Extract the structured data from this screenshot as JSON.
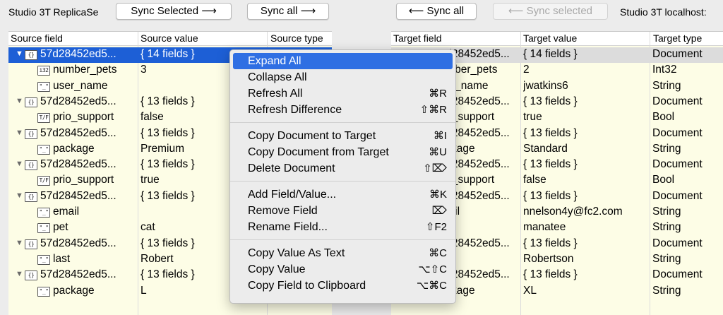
{
  "toolbar": {
    "left_title": "Studio 3T ReplicaSe",
    "sync_selected_right": "Sync Selected ⟶",
    "sync_all_right": "Sync all ⟶",
    "sync_all_left": "⟵ Sync all",
    "sync_selected_left": "⟵ Sync selected",
    "right_title": "Studio 3T localhost:"
  },
  "source": {
    "headers": [
      "Source field",
      "Source value",
      "Source type"
    ],
    "rows": [
      {
        "field": "57d28452ed5...",
        "value": "{ 14 fields }",
        "icon": "{}",
        "expand": true,
        "indent": 0,
        "selected": true
      },
      {
        "field": "number_pets",
        "value": "3",
        "icon": "i32",
        "expand": false,
        "indent": 1
      },
      {
        "field": "user_name",
        "value": "",
        "icon": "\"_\"",
        "expand": false,
        "indent": 1
      },
      {
        "field": "57d28452ed5...",
        "value": "{ 13 fields }",
        "icon": "{}",
        "expand": true,
        "indent": 0
      },
      {
        "field": "prio_support",
        "value": "false",
        "icon": "T/F",
        "expand": false,
        "indent": 1
      },
      {
        "field": "57d28452ed5...",
        "value": "{ 13 fields }",
        "icon": "{}",
        "expand": true,
        "indent": 0
      },
      {
        "field": "package",
        "value": "Premium",
        "icon": "\"_\"",
        "expand": false,
        "indent": 1
      },
      {
        "field": "57d28452ed5...",
        "value": "{ 13 fields }",
        "icon": "{}",
        "expand": true,
        "indent": 0
      },
      {
        "field": "prio_support",
        "value": "true",
        "icon": "T/F",
        "expand": false,
        "indent": 1
      },
      {
        "field": "57d28452ed5...",
        "value": "{ 13 fields }",
        "icon": "{}",
        "expand": true,
        "indent": 0
      },
      {
        "field": "email",
        "value": "",
        "icon": "\"_\"",
        "expand": false,
        "indent": 1
      },
      {
        "field": "pet",
        "value": "cat",
        "icon": "\"_\"",
        "expand": false,
        "indent": 1
      },
      {
        "field": "57d28452ed5...",
        "value": "{ 13 fields }",
        "icon": "{}",
        "expand": true,
        "indent": 0
      },
      {
        "field": "last",
        "value": "Robert",
        "icon": "\"_\"",
        "expand": false,
        "indent": 1
      },
      {
        "field": "57d28452ed5...",
        "value": "{ 13 fields }",
        "icon": "{}",
        "expand": true,
        "indent": 0
      },
      {
        "field": "package",
        "value": "L",
        "icon": "\"_\"",
        "expand": false,
        "indent": 1
      }
    ]
  },
  "target": {
    "headers": [
      "Target field",
      "Target value",
      "Target type"
    ],
    "rows": [
      {
        "field": "57d28452ed5...",
        "value": "{ 14 fields }",
        "type": "Document",
        "selected": true
      },
      {
        "field": "number_pets",
        "value": "2",
        "type": "Int32"
      },
      {
        "field": "user_name",
        "value": "jwatkins6",
        "type": "String"
      },
      {
        "field": "57d28452ed5...",
        "value": "{ 13 fields }",
        "type": "Document"
      },
      {
        "field": "prio_support",
        "value": "true",
        "type": "Bool"
      },
      {
        "field": "57d28452ed5...",
        "value": "{ 13 fields }",
        "type": "Document"
      },
      {
        "field": "package",
        "value": "Standard",
        "type": "String"
      },
      {
        "field": "57d28452ed5...",
        "value": "{ 13 fields }",
        "type": "Document"
      },
      {
        "field": "prio_support",
        "value": "false",
        "type": "Bool"
      },
      {
        "field": "57d28452ed5...",
        "value": "{ 13 fields }",
        "type": "Document"
      },
      {
        "field": "email",
        "value": "nnelson4y@fc2.com",
        "type": "String"
      },
      {
        "field": "pet",
        "value": "manatee",
        "type": "String"
      },
      {
        "field": "57d28452ed5...",
        "value": "{ 13 fields }",
        "type": "Document"
      },
      {
        "field": "last",
        "value": "Robertson",
        "type": "String"
      },
      {
        "field": "57d28452ed5...",
        "value": "{ 13 fields }",
        "type": "Document"
      },
      {
        "field": "package",
        "value": "XL",
        "type": "String"
      }
    ]
  },
  "context_menu": {
    "groups": [
      [
        {
          "label": "Expand All",
          "shortcut": "",
          "highlighted": true
        },
        {
          "label": "Collapse All",
          "shortcut": ""
        },
        {
          "label": "Refresh All",
          "shortcut": "⌘R"
        },
        {
          "label": "Refresh Difference",
          "shortcut": "⇧⌘R"
        }
      ],
      [
        {
          "label": "Copy Document to Target",
          "shortcut": "⌘I"
        },
        {
          "label": "Copy Document from Target",
          "shortcut": "⌘U"
        },
        {
          "label": "Delete Document",
          "shortcut": "⇧⌦"
        }
      ],
      [
        {
          "label": "Add Field/Value...",
          "shortcut": "⌘K"
        },
        {
          "label": "Remove Field",
          "shortcut": "⌦"
        },
        {
          "label": "Rename Field...",
          "shortcut": "⇧F2"
        }
      ],
      [
        {
          "label": "Copy Value As Text",
          "shortcut": "⌘C"
        },
        {
          "label": "Copy Value",
          "shortcut": "⌥⇧C"
        },
        {
          "label": "Copy Field to Clipboard",
          "shortcut": "⌥⌘C"
        }
      ]
    ]
  },
  "colors": {
    "selection": "#1d5fd6",
    "menu_highlight": "#2f6fe3",
    "row_background": "#fdfde6"
  }
}
